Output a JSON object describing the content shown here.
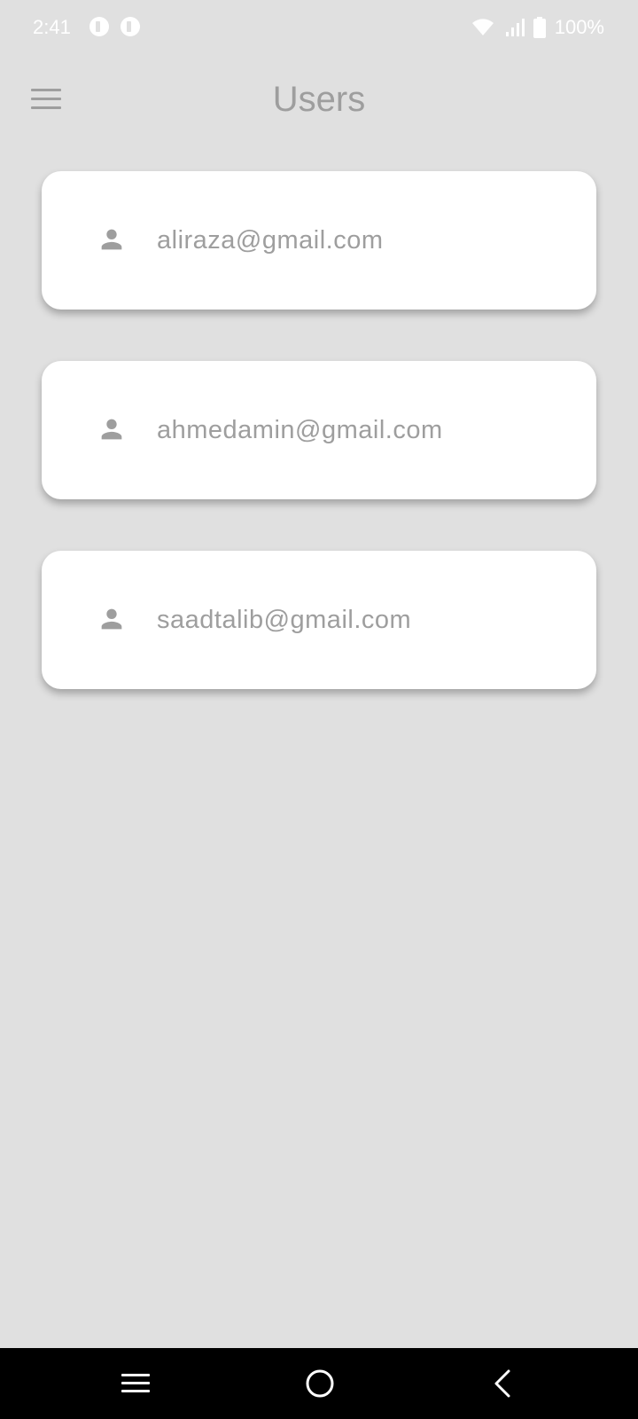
{
  "status_bar": {
    "time": "2:41",
    "battery": "100%"
  },
  "app_bar": {
    "title": "Users",
    "menu_icon": "hamburger-menu-icon"
  },
  "users": [
    {
      "email": "aliraza@gmail.com",
      "icon": "person-icon"
    },
    {
      "email": "ahmedamin@gmail.com",
      "icon": "person-icon"
    },
    {
      "email": "saadtalib@gmail.com",
      "icon": "person-icon"
    }
  ],
  "nav_bar": {
    "recents_icon": "recents-icon",
    "home_icon": "home-icon",
    "back_icon": "back-icon"
  },
  "colors": {
    "background": "#e0e0e0",
    "card": "#ffffff",
    "text": "#9e9e9e",
    "nav_bar": "#000000"
  }
}
